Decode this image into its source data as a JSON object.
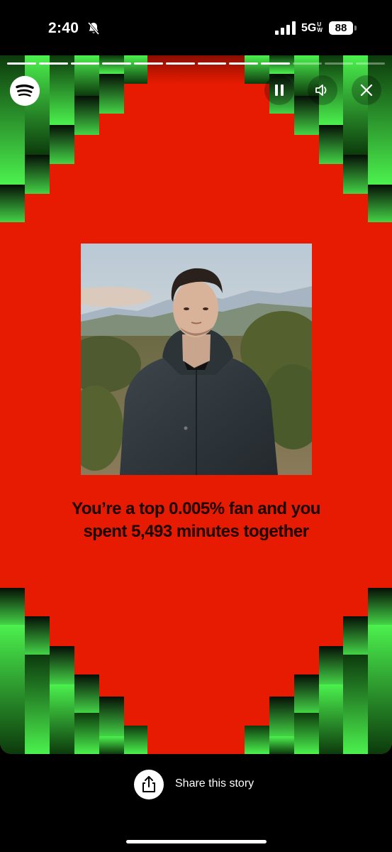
{
  "status_bar": {
    "time": "2:40",
    "network": "5G",
    "network_suffix": "UW",
    "battery": "88",
    "icons": [
      "bell-slash-icon",
      "signal-icon",
      "battery-icon"
    ]
  },
  "story": {
    "progress": {
      "total_segments": 12,
      "completed_segments": 9
    },
    "controls": {
      "logo_icon": "spotify-logo-icon",
      "pause_icon": "pause-icon",
      "volume_icon": "volume-icon",
      "close_icon": "close-icon"
    },
    "headline_line1": "You’re a top 0.005% fan and you",
    "headline_line2": "spent 5,493 minutes together",
    "colors": {
      "background": "#e71b02",
      "accent_green": "#4cf14e",
      "dark_green": "#0d3b0c",
      "text": "#1a0500"
    }
  },
  "share": {
    "label": "Share this story",
    "icon": "share-icon"
  }
}
